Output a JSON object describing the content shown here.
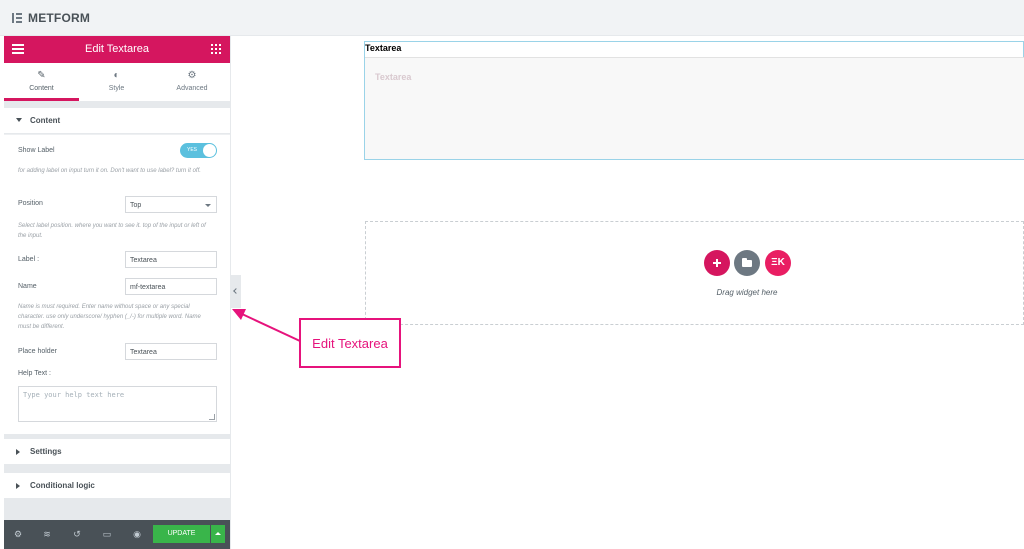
{
  "app": {
    "brand": "METFORM"
  },
  "panel": {
    "title": "Edit Textarea",
    "tabs": [
      {
        "label": "Content",
        "icon": "pencil-icon",
        "active": true
      },
      {
        "label": "Style",
        "icon": "half-circle-icon",
        "active": false
      },
      {
        "label": "Advanced",
        "icon": "gear-icon",
        "active": false
      }
    ],
    "sections": {
      "content": "Content",
      "settings": "Settings",
      "conditional": "Conditional logic"
    },
    "fields": {
      "show_label": {
        "label": "Show Label",
        "toggle_text": "YES",
        "enabled": true,
        "desc": "for adding label on input turn it on. Don't want to use label? turn it off."
      },
      "position": {
        "label": "Position",
        "value": "Top",
        "desc": "Select label position. where you want to see it. top of the input or left of the input."
      },
      "label": {
        "label": "Label :",
        "value": "Textarea"
      },
      "name": {
        "label": "Name",
        "value": "mf-textarea",
        "desc": "Name is must required. Enter name without space or any special character. use only underscore/ hyphen (_/-) for multiple word. Name must be different."
      },
      "placeholder": {
        "label": "Place holder",
        "value": "Textarea"
      },
      "help_text": {
        "label": "Help Text :",
        "placeholder": "Type your help text here"
      }
    },
    "footer": {
      "icons": [
        "gear-icon",
        "layers-icon",
        "history-icon",
        "responsive-icon",
        "eye-icon"
      ],
      "update_label": "UPDATE"
    }
  },
  "canvas": {
    "widget_label": "Textarea",
    "widget_placeholder": "Textarea",
    "drag_text": "Drag widget here",
    "buttons": [
      "add-icon",
      "folder-icon",
      "ekit-icon"
    ]
  },
  "annotation": {
    "text": "Edit Textarea",
    "color": "#e6137c"
  },
  "colors": {
    "accent": "#d5165f",
    "update": "#39b54a",
    "toggle": "#5bc0de"
  }
}
